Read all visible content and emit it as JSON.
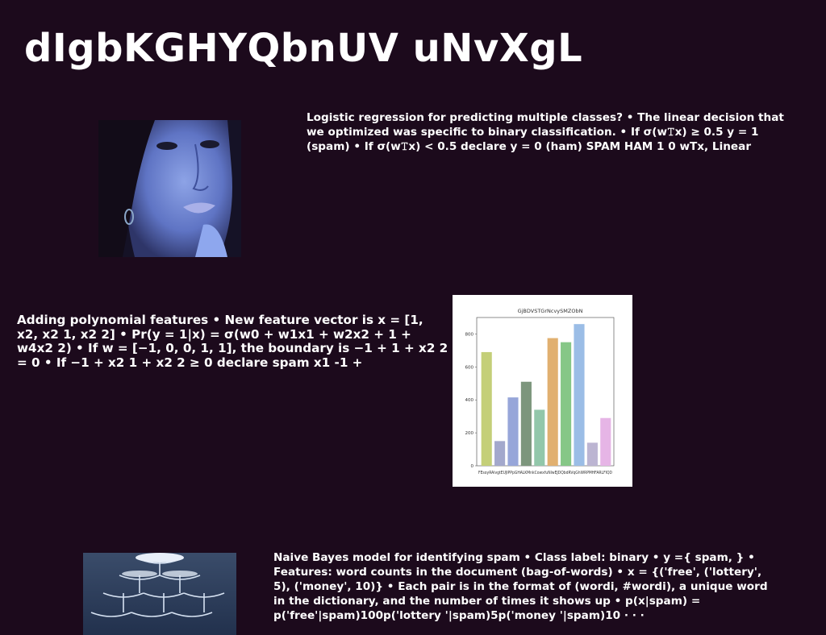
{
  "title": "dIgbKGHYQbnUV uNvXgL",
  "paragraphs": {
    "p1": "Logistic regression for predicting multiple classes? • The linear decision that we optimized was specific to binary classification. • If σ(w𝚃x) ≥ 0.5 y = 1 (spam) • If σ(w𝚃x) < 0.5 declare y = 0 (ham) SPAM HAM 1 0 wTx, Linear",
    "p2": "Adding polynomial features • New feature vector is x = [1, x2, x2 1, x2 2] • Pr(y = 1|x) = σ(w0 + w1x1 + w2x2 + 1 + w4x2 2) • If w = [−1, 0, 0, 1, 1], the boundary is −1 + 1 + x2 2 = 0 • If −1 + x2 1 + x2 2 ≥ 0 declare spam x1 -1 +",
    "p3": "Naive Bayes model for identifying spam • Class label: binary • y ={ spam, } • Features: word counts in the document (bag-of-words) • x = {('free', ('lottery', 5), ('money', 10)} • Each pair is in the format of (wordi, #wordi), a unique word in the dictionary, and the number of times it shows up • p(x|spam) = p('free'|spam)100p('lottery '|spam)5p('money '|spam)10 · · ·"
  },
  "images": {
    "face": "woman-portrait-blue-tone",
    "glass": "champagne-glass-tower"
  },
  "chart_data": {
    "type": "bar",
    "title": "GjBDVSTGrNcvySMZObN",
    "categories": [
      "FEsoy",
      "RAlvgt",
      "EUJIP",
      "PpGHA",
      "LKMn",
      "kCowx",
      "fuNlw",
      "EJDQb",
      "dRVqG",
      "hWRP",
      "MHFARLFIQD"
    ],
    "values": [
      690,
      150,
      415,
      510,
      340,
      775,
      750,
      860,
      140,
      290
    ],
    "colors": [
      "#c4cf78",
      "#a3a8cc",
      "#97a6d9",
      "#7d967d",
      "#92c7aa",
      "#e1b070",
      "#86c787",
      "#9bbde6",
      "#bcb5d2",
      "#e6b5e6"
    ],
    "ylim": [
      0,
      900
    ],
    "yticks": [
      0,
      200,
      400,
      600,
      800
    ],
    "xlabel": "",
    "ylabel": ""
  }
}
